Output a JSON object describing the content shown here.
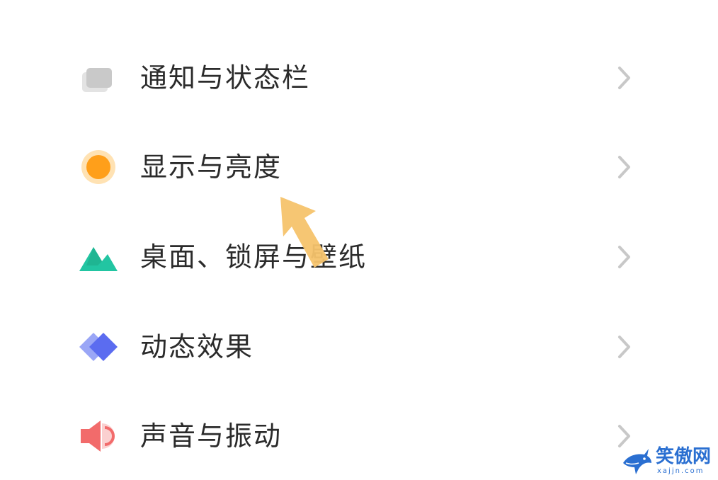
{
  "settings": {
    "items": [
      {
        "label": "通知与状态栏",
        "icon": "notification-statusbar-icon"
      },
      {
        "label": "显示与亮度",
        "icon": "display-brightness-icon"
      },
      {
        "label": "桌面、锁屏与壁纸",
        "icon": "desktop-lockscreen-wallpaper-icon"
      },
      {
        "label": "动态效果",
        "icon": "dynamic-effects-icon"
      },
      {
        "label": "声音与振动",
        "icon": "sound-vibration-icon"
      }
    ],
    "chevron_icon": "chevron-right-icon"
  },
  "annotation": {
    "icon": "pointer-arrow-icon",
    "color": "#f5c36b"
  },
  "watermark": {
    "title": "笑傲网",
    "domain": "xajjn.com",
    "icon": "shark-logo-icon",
    "color": "#2a6fd1"
  },
  "colors": {
    "text": "#2b2b2b",
    "chevron": "#c8c8c8",
    "notification_icon": "#c9c9c9",
    "display_icon": "#ff9f1a",
    "wallpaper_icon": "#22c5a2",
    "effects_icon": "#5b6cf0",
    "sound_icon": "#f26b6b"
  }
}
